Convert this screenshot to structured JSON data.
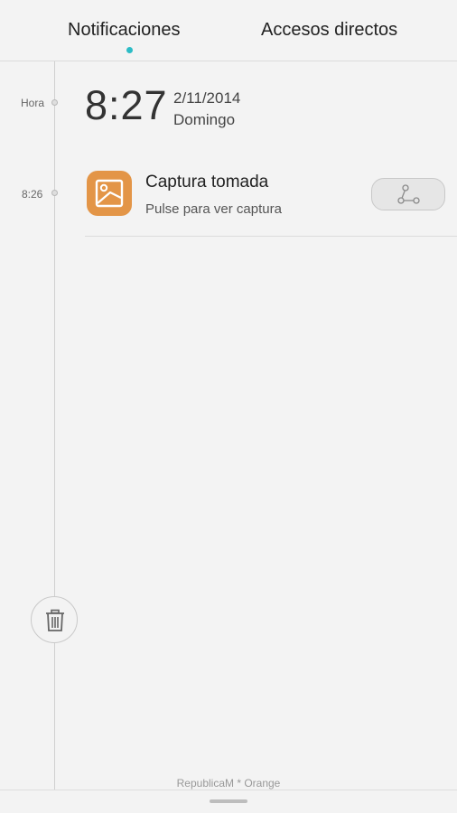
{
  "tabs": [
    {
      "label": "Notificaciones",
      "active": true
    },
    {
      "label": "Accesos directos",
      "active": false
    }
  ],
  "accent_color": "#2cbcc6",
  "timeline": {
    "header_label": "Hora",
    "notif_time": "8:26"
  },
  "clock": {
    "time": "8:27",
    "date": "2/11/2014",
    "day": "Domingo"
  },
  "notification": {
    "icon": "gallery-image-icon",
    "icon_color": "#e39547",
    "title": "Captura tomada",
    "subtitle": "Pulse para ver captura",
    "action_icon": "share-icon"
  },
  "clear_button_icon": "trash-icon",
  "carrier": "RepublicaM * Orange"
}
